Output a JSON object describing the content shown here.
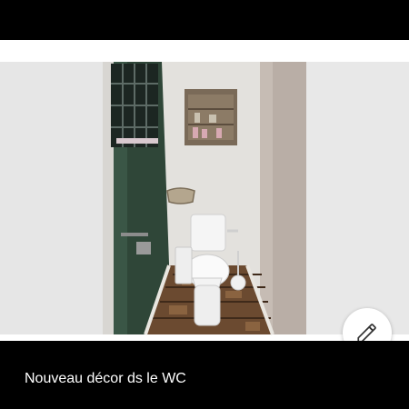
{
  "caption": "Nouveau décor ds le WC",
  "photo": {
    "subject": "toilet-room-photo"
  },
  "edit_button": {
    "icon": "pencil-icon"
  },
  "colors": {
    "background": "#000000",
    "photo_backdrop": "#ffffff",
    "caption_text": "#ffffff",
    "green_door": "#33483b",
    "wall": "#dedcd8"
  }
}
